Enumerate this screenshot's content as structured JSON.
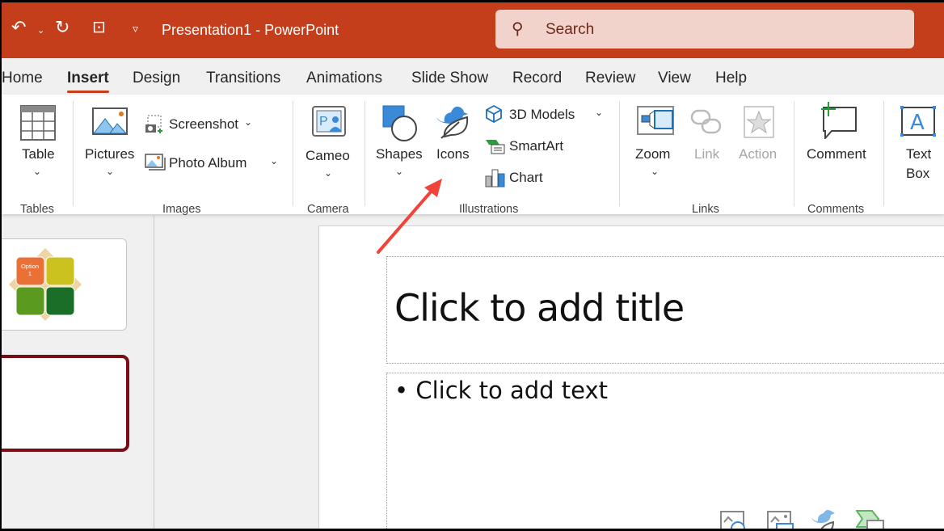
{
  "window": {
    "title": "Presentation1  -  PowerPoint",
    "search_placeholder": "Search"
  },
  "tabs": [
    "Home",
    "Insert",
    "Design",
    "Transitions",
    "Animations",
    "Slide Show",
    "Record",
    "Review",
    "View",
    "Help"
  ],
  "active_tab": "Insert",
  "ribbon": {
    "table": "Table",
    "tables_group": "Tables",
    "pictures": "Pictures",
    "screenshot": "Screenshot",
    "photo_album": "Photo Album",
    "images_group": "Images",
    "cameo": "Cameo",
    "camera_group": "Camera",
    "shapes": "Shapes",
    "icons": "Icons",
    "models3d": "3D Models",
    "smartart": "SmartArt",
    "chart": "Chart",
    "illustrations_group": "Illustrations",
    "zoom": "Zoom",
    "link": "Link",
    "action": "Action",
    "links_group": "Links",
    "comment": "Comment",
    "comments_group": "Comments",
    "textbox_1": "Text",
    "textbox_2": "Box"
  },
  "thumbnail": {
    "option_label": "Option 1"
  },
  "slide": {
    "title_placeholder": "Click to add title",
    "text_placeholder": "Click to add text"
  },
  "colors": {
    "accent": "#c43e1c",
    "arrow": "#f0443a"
  }
}
